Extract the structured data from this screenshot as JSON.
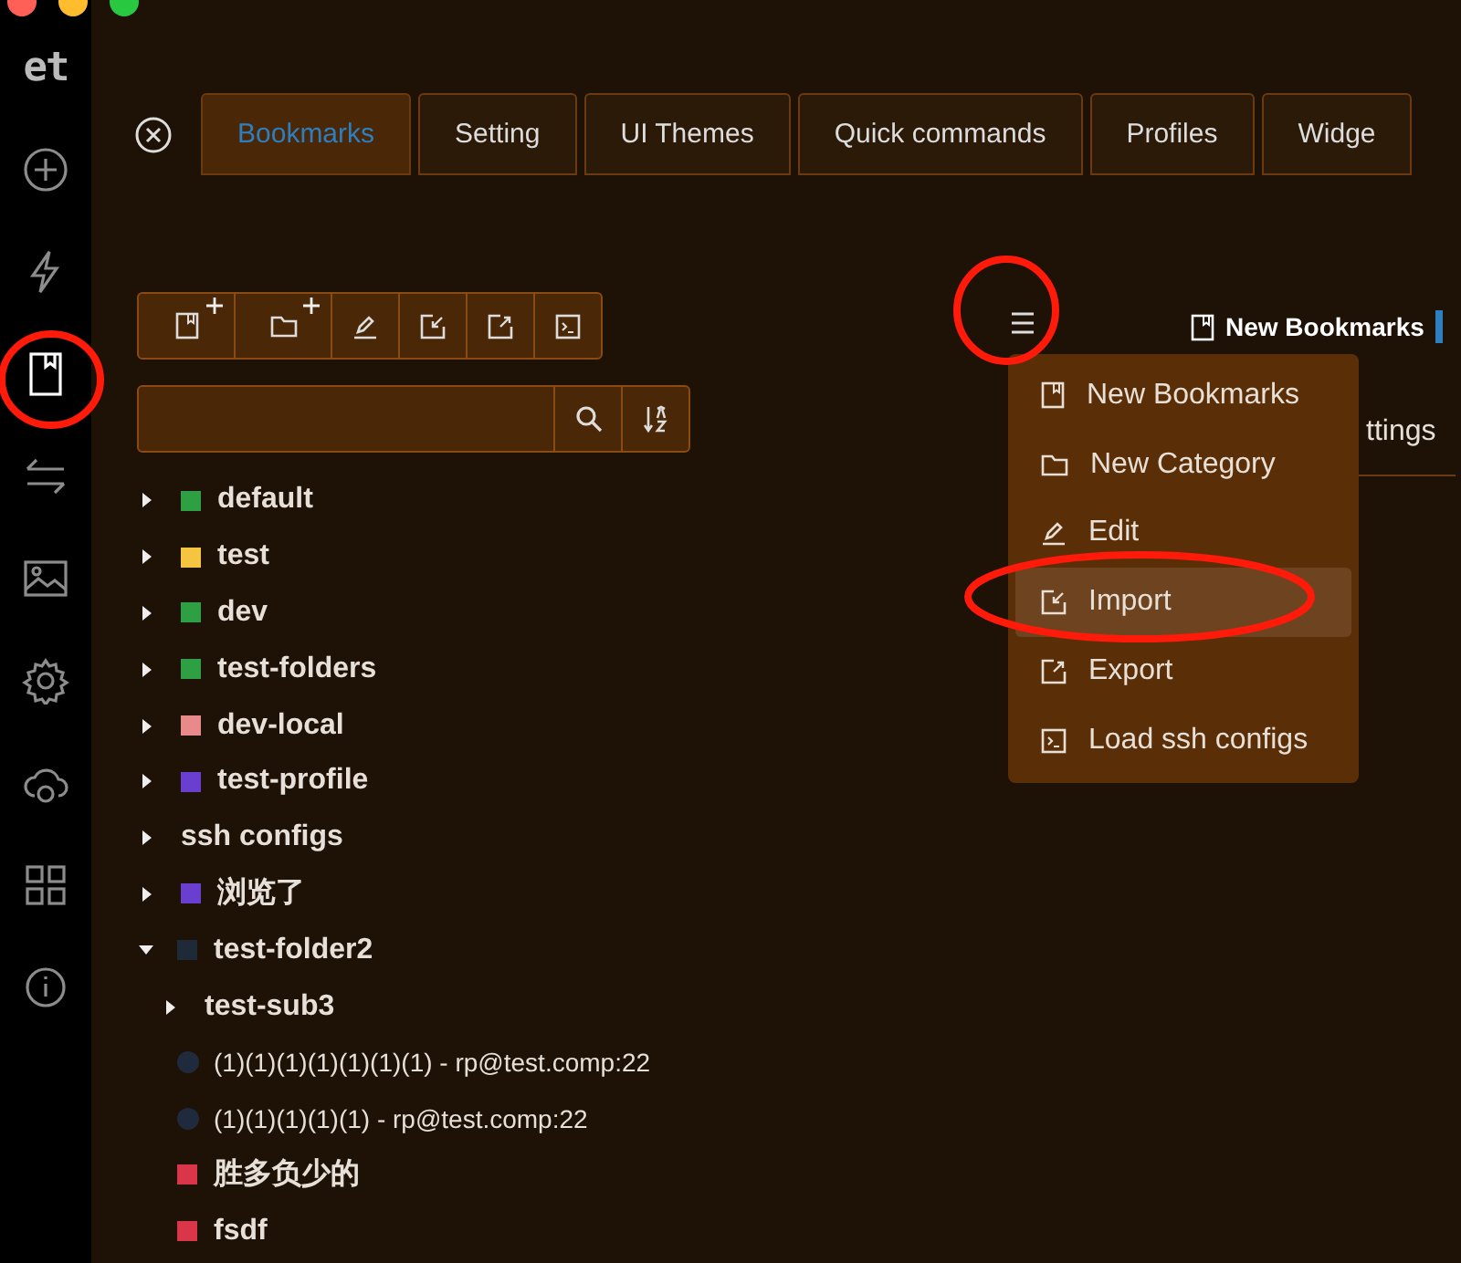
{
  "sidebar": {
    "logo": "et",
    "items": [
      {
        "kind": "plus",
        "selected": false
      },
      {
        "kind": "bolt",
        "selected": false
      },
      {
        "kind": "bookmark",
        "selected": true
      },
      {
        "kind": "transfer",
        "selected": false
      },
      {
        "kind": "image",
        "selected": false
      },
      {
        "kind": "gear",
        "selected": false
      },
      {
        "kind": "cloud",
        "selected": false
      },
      {
        "kind": "grid",
        "selected": false
      },
      {
        "kind": "info",
        "selected": false
      }
    ]
  },
  "tabs": [
    {
      "label": "Bookmarks",
      "selected": true
    },
    {
      "label": "Setting",
      "selected": false
    },
    {
      "label": "UI Themes",
      "selected": false
    },
    {
      "label": "Quick commands",
      "selected": false
    },
    {
      "label": "Profiles",
      "selected": false
    },
    {
      "label": "Widge",
      "selected": false
    }
  ],
  "toolbar": [
    {
      "kind": "new-bookmark"
    },
    {
      "kind": "new-category"
    },
    {
      "kind": "edit"
    },
    {
      "kind": "import"
    },
    {
      "kind": "export"
    },
    {
      "kind": "terminal"
    }
  ],
  "tree": [
    {
      "kind": "folder",
      "label": "default",
      "color": "#2ea043",
      "expanded": false
    },
    {
      "kind": "folder",
      "label": "test",
      "color": "#f5c542",
      "expanded": false
    },
    {
      "kind": "folder",
      "label": "dev",
      "color": "#2ea043",
      "expanded": false
    },
    {
      "kind": "folder",
      "label": "test-folders",
      "color": "#2ea043",
      "expanded": false
    },
    {
      "kind": "folder",
      "label": "dev-local",
      "color": "#e88a8a",
      "expanded": false
    },
    {
      "kind": "folder",
      "label": "test-profile",
      "color": "#6a3fcf",
      "expanded": false
    },
    {
      "kind": "folder",
      "label": "ssh configs",
      "expanded": false
    },
    {
      "kind": "folder",
      "label": "浏览了",
      "color": "#6a3fcf",
      "expanded": false
    },
    {
      "kind": "folder",
      "label": "test-folder2",
      "color": "#1e2a38",
      "expanded": true,
      "children": [
        {
          "kind": "folder",
          "label": "test-sub3",
          "expanded": false
        },
        {
          "kind": "bookmark",
          "label": "(1)(1)(1)(1)(1)(1)(1) - rp@test.comp:22",
          "color": "#1f2a3d"
        },
        {
          "kind": "bookmark",
          "label": "(1)(1)(1)(1)(1) - rp@test.comp:22",
          "color": "#1f2a3d"
        },
        {
          "kind": "tag",
          "label": "胜多负少的",
          "color": "#d9364a"
        },
        {
          "kind": "tag",
          "label": "fsdf",
          "color": "#d9364a"
        }
      ]
    }
  ],
  "panel": {
    "title": "New Bookmarks",
    "tab": "ttings"
  },
  "menu": [
    {
      "kind": "new-bookmark",
      "label": "New Bookmarks",
      "selected": false
    },
    {
      "kind": "new-category",
      "label": "New Category",
      "selected": false
    },
    {
      "kind": "edit",
      "label": "Edit",
      "selected": false
    },
    {
      "kind": "import",
      "label": "Import",
      "selected": true
    },
    {
      "kind": "export",
      "label": "Export",
      "selected": false
    },
    {
      "kind": "terminal",
      "label": "Load ssh configs",
      "selected": false
    }
  ]
}
